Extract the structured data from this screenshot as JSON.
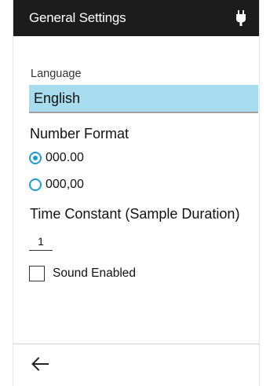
{
  "header": {
    "title": "General Settings",
    "status_icon": "plug-icon"
  },
  "language": {
    "label": "Language",
    "selected_value": "English",
    "highlight_color": "#a7dcef"
  },
  "number_format": {
    "heading": "Number Format",
    "options": [
      {
        "label": "000.00",
        "checked": true
      },
      {
        "label": "000,00",
        "checked": false
      }
    ],
    "accent_color": "#1d9bd7"
  },
  "time_constant": {
    "heading": "Time Constant (Sample Duration)",
    "value": "1"
  },
  "sound": {
    "label": "Sound Enabled",
    "checked": false
  },
  "footer": {
    "back_icon": "arrow-left-icon"
  }
}
